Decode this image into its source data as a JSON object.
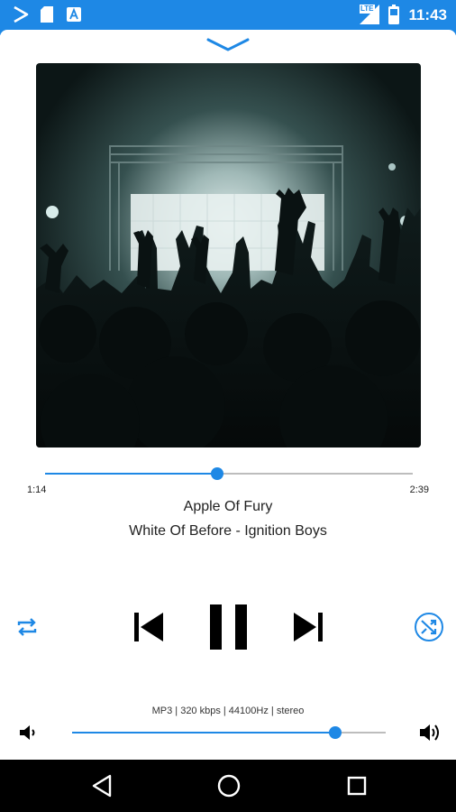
{
  "status_bar": {
    "time": "11:43",
    "network_label": "LTE",
    "icons": [
      "play-store-icon",
      "sd-card-icon",
      "app-a-icon",
      "lte-signal-icon",
      "battery-icon"
    ]
  },
  "player": {
    "elapsed": "1:14",
    "duration": "2:39",
    "progress": 0.468,
    "title": "Apple Of Fury",
    "subtitle": "White Of Before - Ignition Boys",
    "format_info": "MP3 | 320 kbps | 44100Hz | stereo",
    "volume": 0.84,
    "state": "playing"
  },
  "colors": {
    "accent": "#1e88e5",
    "track": "#bdbdbd",
    "text": "#222222",
    "navbar": "#000000"
  },
  "icons": {
    "collapse": "chevron-down-icon",
    "repeat": "repeat-icon",
    "previous": "skip-previous-icon",
    "pause": "pause-icon",
    "next": "skip-next-icon",
    "shuffle": "shuffle-icon",
    "volume_low": "volume-low-icon",
    "volume_high": "volume-high-icon",
    "back": "back-icon",
    "home": "home-icon",
    "recents": "recents-icon"
  }
}
